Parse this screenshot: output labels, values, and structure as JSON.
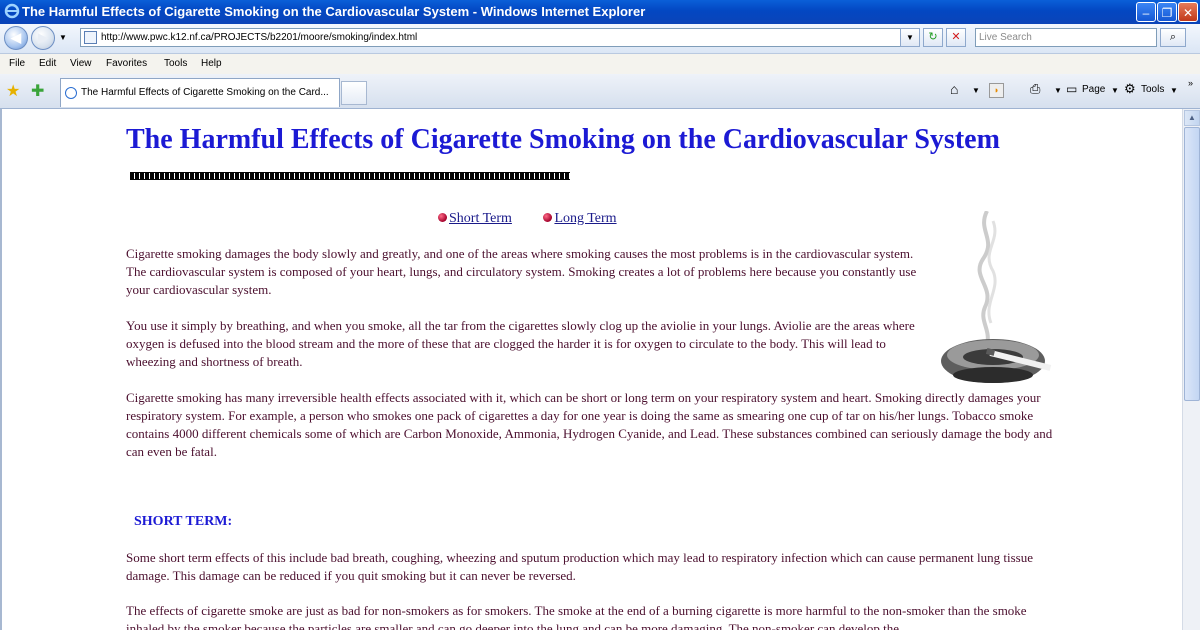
{
  "window": {
    "title": "The Harmful Effects of Cigarette Smoking on the Cardiovascular System - Windows Internet Explorer"
  },
  "address": {
    "url": "http://www.pwc.k12.nf.ca/PROJECTS/b2201/moore/smoking/index.html",
    "search_placeholder": "Live Search"
  },
  "menu": [
    "File",
    "Edit",
    "View",
    "Favorites",
    "Tools",
    "Help"
  ],
  "tab": {
    "label": "The Harmful Effects of Cigarette Smoking on the Card..."
  },
  "toolbar": {
    "page_label": "Page",
    "tools_label": "Tools"
  },
  "page": {
    "title": "The Harmful Effects of Cigarette Smoking on the Cardiovascular System",
    "links": [
      "Short Term",
      "Long Term"
    ],
    "paragraphs": [
      "Cigarette smoking damages the body slowly and greatly, and one of the areas where smoking causes the most problems is in the cardiovascular system.  The cardiovascular system is composed of your heart, lungs, and circulatory system.  Smoking creates a lot of problems here because you constantly use your cardiovascular system.",
      "You use it simply by breathing, and when you smoke, all the tar from the cigarettes slowly clog up the aviolie in your lungs.  Aviolie are the areas where oxygen is defused into the blood stream and the more of these that are clogged the harder it is for oxygen to circulate to the body.  This will lead to wheezing and shortness of breath.",
      "Cigarette smoking has many irreversible health effects associated with it, which can be short or long term on your respiratory system and heart.  Smoking directly damages your respiratory system.  For example, a person who smokes one pack of cigarettes a day for one year is doing the same as smearing one cup of tar on his/her lungs.  Tobacco smoke contains 4000 different chemicals some of which are Carbon Monoxide, Ammonia, Hydrogen Cyanide, and Lead.  These substances combined can seriously damage the body and can even be fatal.",
      "Some short term effects of this include bad breath, coughing, wheezing and sputum production which may lead to respiratory infection which can cause permanent lung tissue damage.  This damage can be reduced if you quit smoking but it can never be reversed.",
      "The effects of cigarette smoke are just as bad for non-smokers as for smokers.  The smoke at the end of a burning cigarette is more harmful to the non-smoker than the smoke inhaled by the smoker because the particles are smaller and can go deeper into the lung and can be more damaging.  The non-smoker can develop the"
    ],
    "section_heading": "SHORT TERM:"
  },
  "icons": {
    "ie": "ie-logo-icon",
    "back": "back-arrow-icon",
    "forward": "forward-arrow-icon",
    "refresh": "refresh-icon",
    "stop": "stop-icon",
    "search": "search-icon",
    "home": "home-icon",
    "feeds": "rss-icon",
    "print": "print-icon"
  }
}
